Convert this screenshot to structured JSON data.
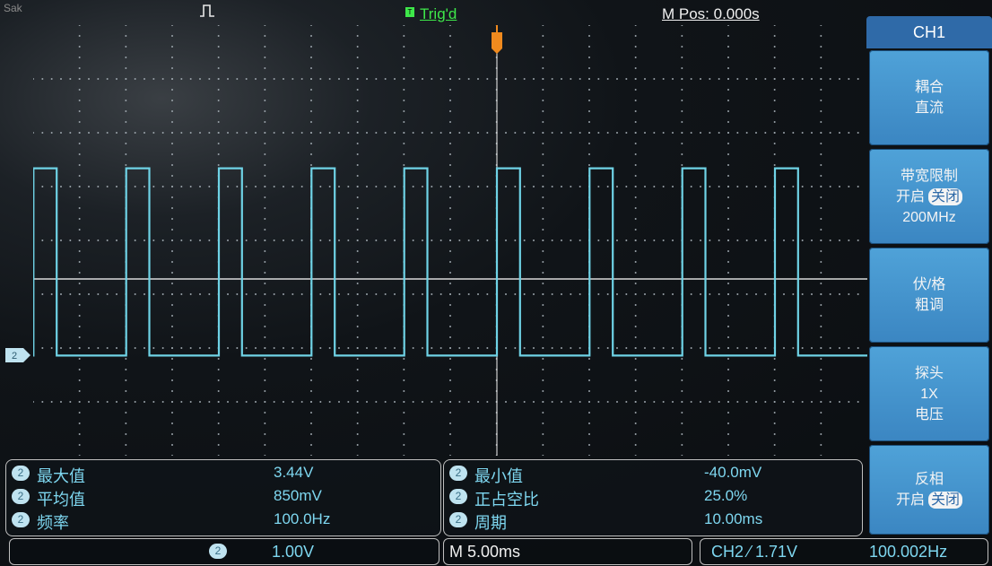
{
  "status": {
    "acq_label": "Sak",
    "trig_box": "T",
    "trig_status": "Trig'd",
    "mpos": "M Pos: 0.000s"
  },
  "channel_marker": "2",
  "menu": {
    "title": "CH1",
    "buttons": [
      {
        "line1": "耦合",
        "line2": "直流",
        "line3": ""
      },
      {
        "line1": "带宽限制",
        "line2_left": "开启",
        "line2_sel": "关闭",
        "line3": "200MHz"
      },
      {
        "line1": "伏/格",
        "line2": "粗调",
        "line3": ""
      },
      {
        "line1": "探头",
        "line2": "1X",
        "line3": "电压"
      },
      {
        "line1": "反相",
        "line2_left": "开启",
        "line2_sel": "关闭"
      }
    ]
  },
  "measurements": {
    "left": [
      {
        "ch": "2",
        "name": "最大值",
        "value": "3.44V"
      },
      {
        "ch": "2",
        "name": "平均值",
        "value": "850mV"
      },
      {
        "ch": "2",
        "name": "频率",
        "value": "100.0Hz"
      }
    ],
    "right": [
      {
        "ch": "2",
        "name": "最小值",
        "value": "-40.0mV"
      },
      {
        "ch": "2",
        "name": "正占空比",
        "value": "25.0%"
      },
      {
        "ch": "2",
        "name": "周期",
        "value": "10.00ms"
      }
    ]
  },
  "bottom": {
    "ch_badge": "2",
    "volts_div": "1.00V",
    "timebase": "M 5.00ms",
    "trigger": "CH2 ⁄ 1.71V",
    "freq": "100.002Hz"
  },
  "colors": {
    "trace": "#6fd3e6",
    "trigger_level": "#f0f0f0",
    "trig_status": "#3ee84a",
    "menu": "#3b86c2",
    "trigger_marker": "#f08a1e"
  },
  "waveform": {
    "signal": "square",
    "high_v": 3.44,
    "low_v": -0.04,
    "duty_cycle_pct": 25.0,
    "period_ms": 10.0,
    "volts_per_div": 1.0,
    "time_per_div_ms": 5.0,
    "trigger_level_v": 1.71
  }
}
